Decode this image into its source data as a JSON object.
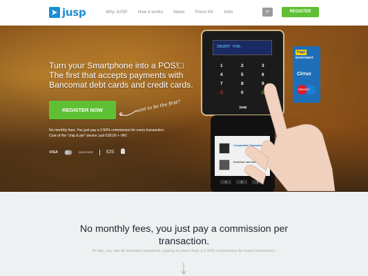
{
  "header": {
    "logo_text": "jusp",
    "nav": [
      "Why JUSP",
      "How it works",
      "News",
      "Press Kit",
      "Jobs"
    ],
    "lang_label": "en",
    "register_label": "REGISTER"
  },
  "hero": {
    "title_lines": [
      "Turn your Smartphone into a POS!□",
      "The first that accepts payments with",
      "Bancomat debt cards and credit cards."
    ],
    "cta_label": "REGISTER NOW",
    "note": "want to be the first?",
    "small_lines": [
      "No monthly fees. You just pay a 2.50% commission for every transaction.",
      "Cost of the \"chip & pin\" device: just €39.00 + VAT."
    ],
    "cards": [
      "VISA",
      "MC",
      "DISCOVER",
      "iOS",
      "Android"
    ]
  },
  "device": {
    "screen_text": "INSERT PIN:",
    "keys": [
      "1",
      "2",
      "3",
      "4",
      "5",
      "6",
      "7",
      "8",
      "9",
      "C",
      "0",
      "OK"
    ],
    "brand": "jusp",
    "phone_item1": "Completato Transazione",
    "phone_item2": "Inserisci una transazione",
    "phone_keys": [
      "1",
      "2",
      "3",
      "4",
      "5",
      "6",
      "7",
      "8",
      "9"
    ],
    "card_pago": "Pago",
    "card_bancomat": "BANCOMAT",
    "card_cirrus": "Cirrus",
    "card_maestro": "Maestro"
  },
  "lower": {
    "title_lines": [
      "No monthly fees, you just pay a commission per",
      "transaction."
    ],
    "subtitle": "At last, you can do business anywhere, paying no more than a 2.50% commission for every transaction."
  },
  "colors": {
    "brand_blue": "#1b8fd6",
    "cta_green": "#5fc033",
    "lower_bg": "#eef1f1"
  }
}
